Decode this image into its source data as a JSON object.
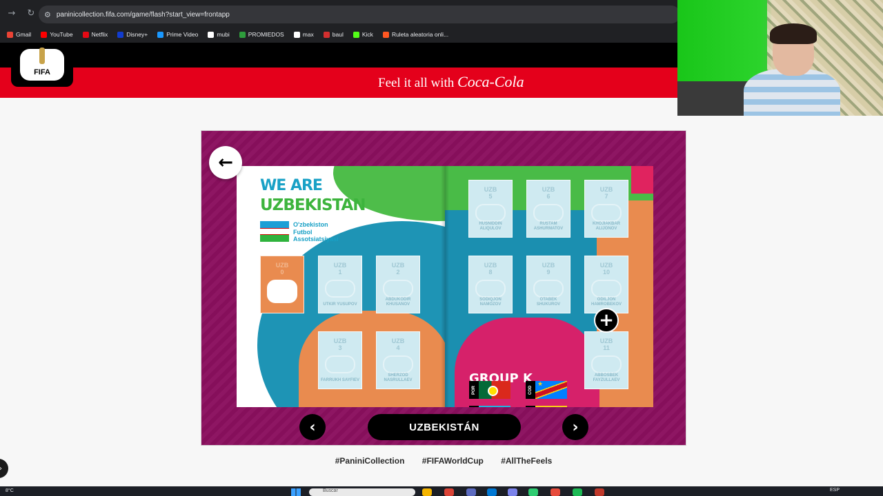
{
  "browser": {
    "url": "paninicollection.fifa.com/game/flash?start_view=frontapp",
    "bookmarks": [
      {
        "label": "Gmail",
        "color": "#ea4335"
      },
      {
        "label": "YouTube",
        "color": "#ff0000"
      },
      {
        "label": "Netflix",
        "color": "#e50914"
      },
      {
        "label": "Disney+",
        "color": "#113ccf"
      },
      {
        "label": "Prime Video",
        "color": "#1a98ff"
      },
      {
        "label": "mubi",
        "color": "#ffffff"
      },
      {
        "label": "PROMIEDOS",
        "color": "#2e9d3c"
      },
      {
        "label": "max",
        "color": "#ffffff"
      },
      {
        "label": "baul",
        "color": "#d32f2f"
      },
      {
        "label": "Kick",
        "color": "#53fc18"
      },
      {
        "label": "Ruleta aleatoria onli...",
        "color": "#ff5722"
      }
    ]
  },
  "header": {
    "logo_text": "FIFA",
    "slogan": "Feel it all with",
    "slogan_brand": "Coca-Cola",
    "colors": {
      "black": "#000000",
      "red": "#e4001b"
    }
  },
  "album": {
    "title_line1": "WE ARE",
    "title_line2": "UZBEKISTAN",
    "association": [
      "O'zbekiston",
      "Futbol",
      "Assotsiatsiyasi"
    ],
    "stickers": [
      {
        "code": "UZB",
        "num": "0",
        "name": "",
        "style": "orange"
      },
      {
        "code": "UZB",
        "num": "1",
        "name": "UTKIR YUSUPOV",
        "style": "empty"
      },
      {
        "code": "UZB",
        "num": "2",
        "name": "ABDUKODIR KHUSANOV",
        "style": "empty"
      },
      {
        "code": "UZB",
        "num": "3",
        "name": "FARRUKH SAYFIEV",
        "style": "empty"
      },
      {
        "code": "UZB",
        "num": "4",
        "name": "SHERZOD NASRULLAEV",
        "style": "empty"
      },
      {
        "code": "UZB",
        "num": "5",
        "name": "HUSNIDDIN ALIQULOV",
        "style": "empty"
      },
      {
        "code": "UZB",
        "num": "6",
        "name": "RUSTAM ASHURMATOV",
        "style": "empty"
      },
      {
        "code": "UZB",
        "num": "7",
        "name": "KHOJIAKBAR ALIJONOV",
        "style": "empty"
      },
      {
        "code": "UZB",
        "num": "8",
        "name": "SODIQJON NAMOZOV",
        "style": "empty"
      },
      {
        "code": "UZB",
        "num": "9",
        "name": "OTABEK SHUKUROV",
        "style": "empty"
      },
      {
        "code": "UZB",
        "num": "10",
        "name": "ODILJON HAMROBEKOV",
        "style": "empty"
      },
      {
        "code": "UZB",
        "num": "11",
        "name": "ABBOSBEK FAYZULLAEV",
        "style": "empty"
      }
    ],
    "group": {
      "title": "GROUP K",
      "teams": [
        {
          "code": "POR",
          "flag": "por"
        },
        {
          "code": "COD",
          "flag": "cod"
        },
        {
          "code": "UZB",
          "flag": "uzb"
        },
        {
          "code": "COL",
          "flag": "col"
        }
      ]
    },
    "colors": {
      "frame": "#8a0f5e",
      "blue": "#1b8fb0",
      "green": "#4ebd4a",
      "orange": "#e98b4f",
      "magenta": "#d6216a"
    }
  },
  "controls": {
    "back_icon": "←",
    "prev_icon": "‹",
    "next_icon": "›",
    "add_icon": "+",
    "country_name": "UZBEKISTÁN"
  },
  "hashtags": [
    "#PaniniCollection",
    "#FIFAWorldCup",
    "#AllTheFeels"
  ],
  "taskbar": {
    "temperature": "8°C",
    "search_placeholder": "Buscar",
    "language": "ESP"
  }
}
